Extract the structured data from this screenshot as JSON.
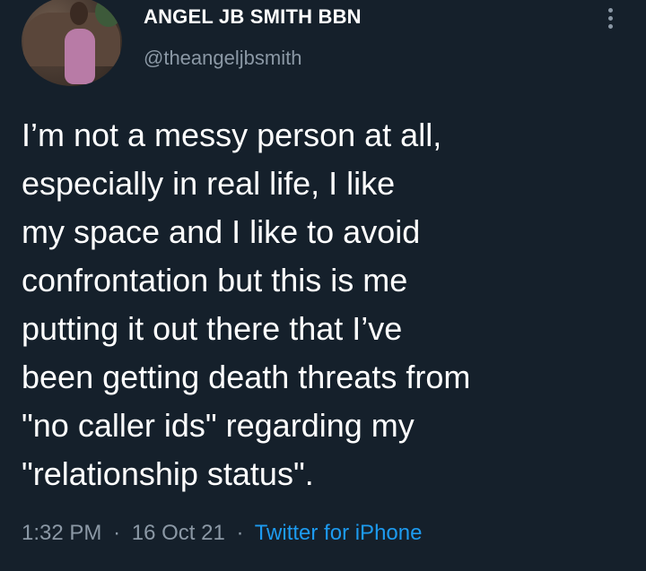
{
  "tweet": {
    "author_name": "ANGEL JB SMITH BBN",
    "author_handle": "@theangeljbsmith",
    "text": "I’m not a messy person at all,\nespecially in real life, I like\nmy space and I like to avoid\nconfrontation but this is me\nputting it out there that I’ve\nbeen getting death threats from\n\"no caller ids\" regarding my\n\"relationship status\".",
    "time": "1:32 PM",
    "date": "16 Oct 21",
    "separator": "·",
    "source": "Twitter for iPhone"
  },
  "colors": {
    "background": "#15202b",
    "text_primary": "#ffffff",
    "text_secondary": "#8b98a5",
    "link": "#1d9bf0"
  },
  "icons": {
    "more": "more-options-icon"
  }
}
